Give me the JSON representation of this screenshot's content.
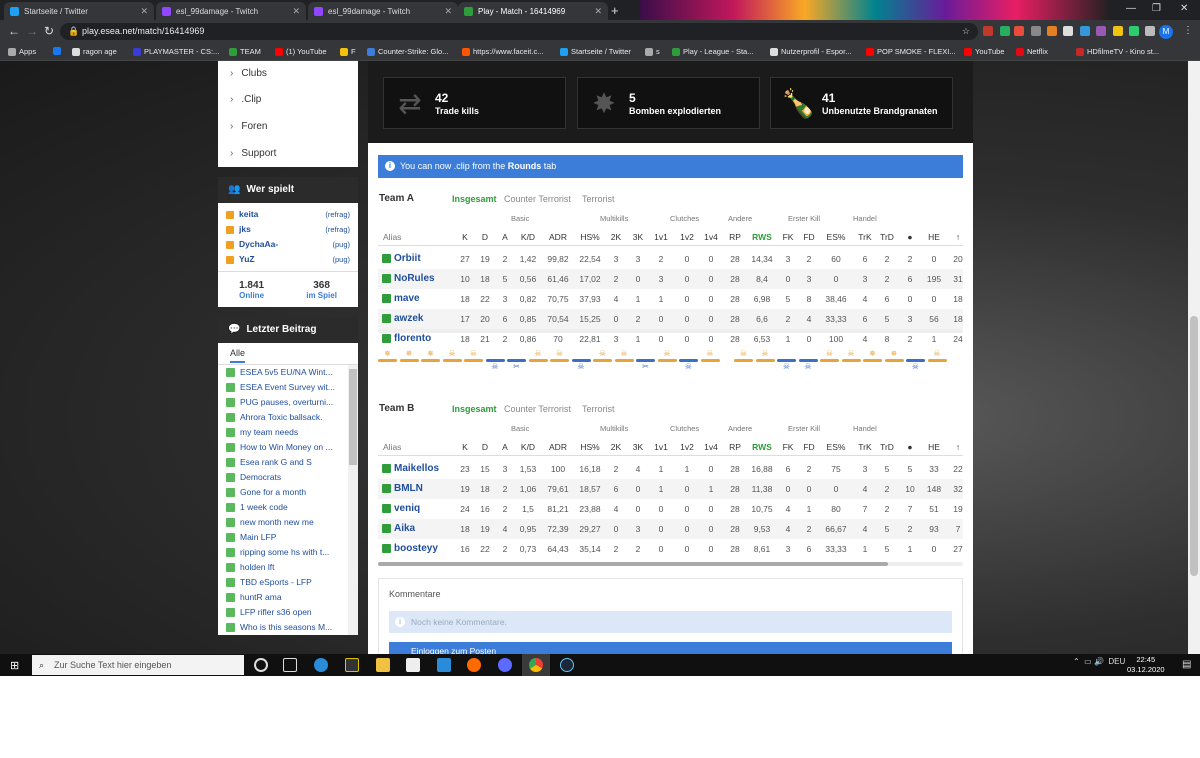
{
  "browser": {
    "tabs": [
      {
        "label": "Startseite / Twitter",
        "color": "#1da1f2"
      },
      {
        "label": "esl_99damage - Twitch",
        "color": "#9146ff"
      },
      {
        "label": "esl_99damage - Twitch",
        "color": "#9146ff"
      },
      {
        "label": "Play - Match - 16414969",
        "color": "#2e9d3a"
      }
    ],
    "url": "play.esea.net/match/16414969",
    "avatar_letter": "M",
    "bookmarks": [
      {
        "label": "Apps",
        "color": "#aaa"
      },
      {
        "label": "",
        "color": "#1877f2"
      },
      {
        "label": "ragon age",
        "color": "#ddd"
      },
      {
        "label": "PLAYMASTER - CS:...",
        "color": "#3b3bd8"
      },
      {
        "label": "TEAM",
        "color": "#2e9d3a"
      },
      {
        "label": "(1) YouTube",
        "color": "#ff0000"
      },
      {
        "label": "F",
        "color": "#f4c20d"
      },
      {
        "label": "Counter-Strike: Glo...",
        "color": "#3b7dd8"
      },
      {
        "label": "https://www.faceit.c...",
        "color": "#ff5500"
      },
      {
        "label": "Startseite / Twitter",
        "color": "#1da1f2"
      },
      {
        "label": "s",
        "color": "#aaa"
      },
      {
        "label": "Play - League - Sta...",
        "color": "#2e9d3a"
      },
      {
        "label": "Nutzerprofil - Espor...",
        "color": "#ddd"
      },
      {
        "label": "POP SMOKE - FLEXI...",
        "color": "#ff0000"
      },
      {
        "label": "YouTube",
        "color": "#ff0000"
      },
      {
        "label": "Netflix",
        "color": "#e50914"
      },
      {
        "label": "HDfilmeTV - Kino st...",
        "color": "#c62828"
      }
    ]
  },
  "sidebar": {
    "menu": [
      "Clubs",
      ".Clip",
      "Foren",
      "Support"
    ],
    "who_plays_title": "Wer spielt",
    "players": [
      {
        "name": "keita",
        "tag": "(refrag)"
      },
      {
        "name": "jks",
        "tag": "(refrag)"
      },
      {
        "name": "DychaAa-",
        "tag": "(pug)"
      },
      {
        "name": "YuZ",
        "tag": "(pug)"
      }
    ],
    "online_count": "1.841",
    "online_label": "Online",
    "ingame_count": "368",
    "ingame_label": "im Spiel",
    "last_post_title": "Letzter Beitrag",
    "filter_tab": "Alle",
    "threads": [
      "ESEA 5v5 EU/NA Wint...",
      "ESEA Event Survey wit...",
      "PUG pauses, overturni...",
      "Ahrora Toxic ballsack.",
      "my team needs",
      "How to Win Money on ...",
      "Esea rank G and S",
      "Democrats",
      "Gone for a month",
      "1 week code",
      "new month new me",
      "Main LFP",
      "ripping some hs with t...",
      "holden lft",
      "TBD eSports - LFP",
      "huntR ama",
      "LFP rifler s36 open",
      "Who is this seasons M..."
    ]
  },
  "highlights": [
    {
      "value": "42",
      "label": "Trade kills",
      "icon": "trade-icon"
    },
    {
      "value": "5",
      "label": "Bomben explodierten",
      "icon": "explosion-icon"
    },
    {
      "value": "41",
      "label": "Unbenutzte Brandgranaten",
      "icon": "molotov-icon"
    }
  ],
  "info_text_before": "You can now .clip from the ",
  "info_text_bold": "Rounds",
  "info_text_after": " tab",
  "stat_tabs": [
    "Insgesamt",
    "Counter Terrorist",
    "Terrorist"
  ],
  "groups": [
    "Basic",
    "Multikills",
    "Clutches",
    "Andere",
    "Erster Kill",
    "Handel"
  ],
  "columns": [
    "K",
    "D",
    "A",
    "K/D",
    "ADR",
    "HS%",
    "2K",
    "3K",
    "1v1",
    "1v2",
    "1v4",
    "RP",
    "RWS",
    "FK",
    "FD",
    "ES%",
    "TrK",
    "TrD",
    "●",
    "HE",
    "↑"
  ],
  "alias_label": "Alias",
  "teams": [
    {
      "name": "Team A",
      "rows": [
        {
          "name": "Orbiit",
          "vals": [
            "27",
            "19",
            "2",
            "1,42",
            "99,82",
            "22,54",
            "3",
            "3",
            "2",
            "0",
            "0",
            "28",
            "14,34",
            "3",
            "2",
            "60",
            "6",
            "2",
            "2",
            "0",
            "20"
          ]
        },
        {
          "name": "NoRules",
          "vals": [
            "10",
            "18",
            "5",
            "0,56",
            "61,46",
            "17,02",
            "2",
            "0",
            "3",
            "0",
            "0",
            "28",
            "8,4",
            "0",
            "3",
            "0",
            "3",
            "2",
            "6",
            "195",
            "31"
          ]
        },
        {
          "name": "mave",
          "vals": [
            "18",
            "22",
            "3",
            "0,82",
            "70,75",
            "37,93",
            "4",
            "1",
            "1",
            "0",
            "0",
            "28",
            "6,98",
            "5",
            "8",
            "38,46",
            "4",
            "6",
            "0",
            "0",
            "18"
          ]
        },
        {
          "name": "awzek",
          "vals": [
            "17",
            "20",
            "6",
            "0,85",
            "70,54",
            "15,25",
            "0",
            "2",
            "0",
            "0",
            "0",
            "28",
            "6,6",
            "2",
            "4",
            "33,33",
            "6",
            "5",
            "3",
            "56",
            "18"
          ]
        },
        {
          "name": "florento",
          "vals": [
            "18",
            "21",
            "2",
            "0,86",
            "70",
            "22,81",
            "3",
            "1",
            "0",
            "0",
            "0",
            "28",
            "6,53",
            "1",
            "0",
            "100",
            "4",
            "8",
            "2",
            "1",
            "24"
          ]
        }
      ]
    },
    {
      "name": "Team B",
      "rows": [
        {
          "name": "Maikellos",
          "vals": [
            "23",
            "15",
            "3",
            "1,53",
            "100",
            "16,18",
            "2",
            "4",
            "1",
            "1",
            "0",
            "28",
            "16,88",
            "6",
            "2",
            "75",
            "3",
            "5",
            "5",
            "33",
            "22"
          ]
        },
        {
          "name": "BMLN",
          "vals": [
            "19",
            "18",
            "2",
            "1,06",
            "79,61",
            "18,57",
            "6",
            "0",
            "1",
            "0",
            "1",
            "28",
            "11,38",
            "0",
            "0",
            "0",
            "4",
            "2",
            "10",
            "148",
            "32"
          ]
        },
        {
          "name": "veniq",
          "vals": [
            "24",
            "16",
            "2",
            "1,5",
            "81,21",
            "23,88",
            "4",
            "0",
            "0",
            "0",
            "0",
            "28",
            "10,75",
            "4",
            "1",
            "80",
            "7",
            "2",
            "7",
            "51",
            "19"
          ]
        },
        {
          "name": "Aika",
          "vals": [
            "18",
            "19",
            "4",
            "0,95",
            "72,39",
            "29,27",
            "0",
            "3",
            "0",
            "0",
            "0",
            "28",
            "9,53",
            "4",
            "2",
            "66,67",
            "4",
            "5",
            "2",
            "93",
            "7"
          ]
        },
        {
          "name": "boosteyy",
          "vals": [
            "16",
            "22",
            "2",
            "0,73",
            "64,43",
            "35,14",
            "2",
            "2",
            "0",
            "0",
            "0",
            "28",
            "8,61",
            "3",
            "6",
            "33,33",
            "1",
            "5",
            "1",
            "0",
            "27"
          ]
        }
      ]
    }
  ],
  "rounds": [
    {
      "side": "t",
      "sym": "✵"
    },
    {
      "side": "t",
      "sym": "✵"
    },
    {
      "side": "t",
      "sym": "✵"
    },
    {
      "side": "t",
      "sym": "☠"
    },
    {
      "side": "t",
      "sym": "☠"
    },
    {
      "side": "ct",
      "sym": "☠"
    },
    {
      "side": "ct",
      "sym": "✂"
    },
    {
      "side": "t",
      "sym": "☠"
    },
    {
      "side": "t",
      "sym": "☠"
    },
    {
      "side": "ct",
      "sym": "☠"
    },
    {
      "side": "t",
      "sym": "☠"
    },
    {
      "side": "t",
      "sym": "☠"
    },
    {
      "side": "ct",
      "sym": "✂"
    },
    {
      "side": "t",
      "sym": "☠"
    },
    {
      "side": "ct",
      "sym": "☠"
    },
    {
      "side": "t",
      "sym": "☠"
    },
    {
      "side": "gap",
      "sym": ""
    },
    {
      "side": "t",
      "sym": "☠"
    },
    {
      "side": "t",
      "sym": "☠"
    },
    {
      "side": "ct",
      "sym": "☠"
    },
    {
      "side": "ct",
      "sym": "☠"
    },
    {
      "side": "t",
      "sym": "☠"
    },
    {
      "side": "t",
      "sym": "☠"
    },
    {
      "side": "t",
      "sym": "✵"
    },
    {
      "side": "t",
      "sym": "✵"
    },
    {
      "side": "ct",
      "sym": "☠"
    },
    {
      "side": "t",
      "sym": "☠"
    }
  ],
  "comments": {
    "title": "Kommentare",
    "none": "Noch keine Kommentare.",
    "login": "Einloggen zum Posten"
  },
  "taskbar": {
    "search_placeholder": "Zur Suche Text hier eingeben",
    "lang": "DEU",
    "time": "22:45",
    "date": "03.12.2020"
  }
}
